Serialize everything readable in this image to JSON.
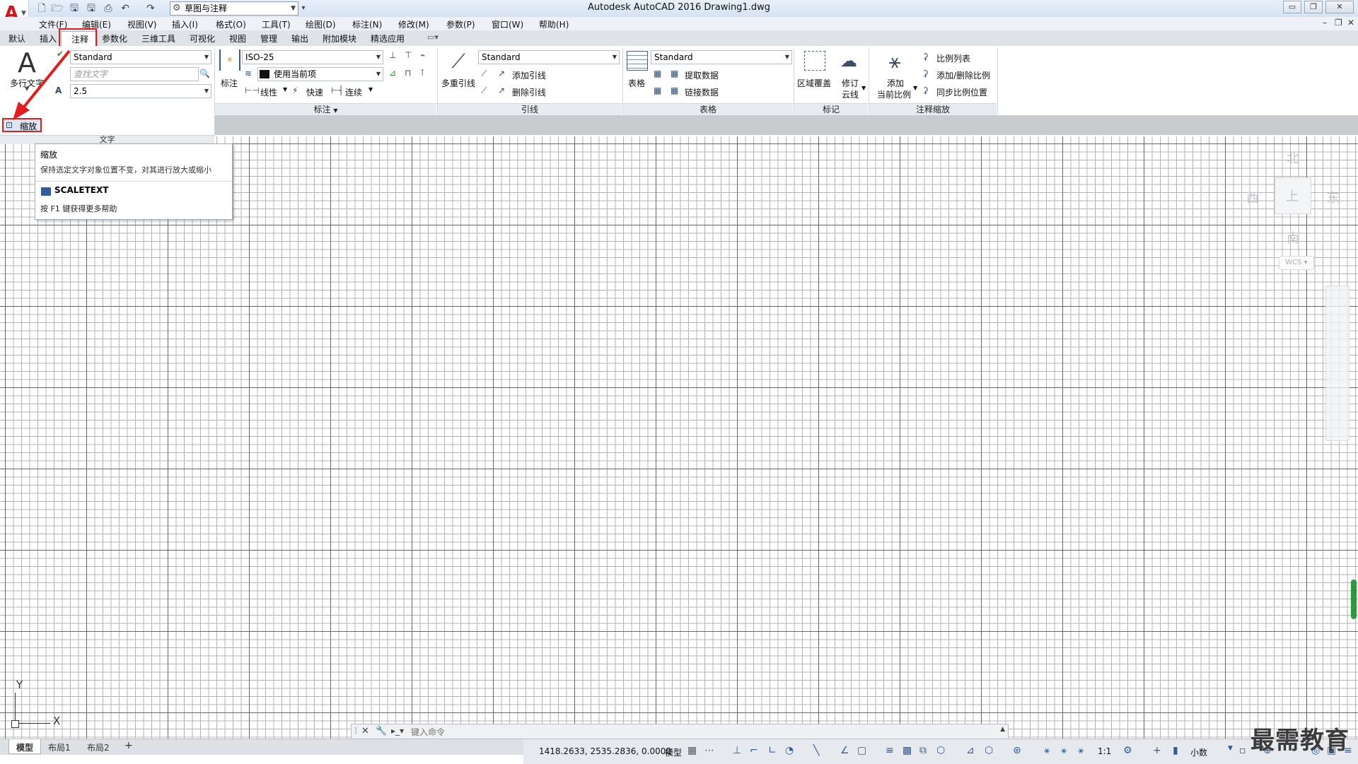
{
  "window": {
    "title": "Autodesk AutoCAD 2016    Drawing1.dwg",
    "workspace": "草图与注释",
    "controls": [
      "▭",
      "❐",
      "✕"
    ],
    "doc_controls": [
      "–",
      "❐",
      "✕"
    ]
  },
  "menu": [
    "文件(F)",
    "编辑(E)",
    "视图(V)",
    "插入(I)",
    "格式(O)",
    "工具(T)",
    "绘图(D)",
    "标注(N)",
    "修改(M)",
    "参数(P)",
    "窗口(W)",
    "帮助(H)"
  ],
  "ribbon_tabs": [
    "默认",
    "插入",
    "注释",
    "参数化",
    "三维工具",
    "可视化",
    "视图",
    "管理",
    "输出",
    "附加模块",
    "精选应用"
  ],
  "active_tab": "注释",
  "ribbon": {
    "text": {
      "mtext_label": "多行文字",
      "style": "Standard",
      "find_placeholder": "查找文字",
      "height": "2.5",
      "panel_title": "文字",
      "scale_button": "缩放"
    },
    "dimension": {
      "label": "标注",
      "style": "ISO-25",
      "layer": "使用当前项",
      "linear": "线性",
      "quick": "快速",
      "continue": "连续",
      "panel_title": "标注"
    },
    "leader": {
      "label": "多重引线",
      "style": "Standard",
      "add": "添加引线",
      "remove": "删除引线",
      "panel_title": "引线"
    },
    "table": {
      "label": "表格",
      "style": "Standard",
      "extract": "提取数据",
      "link": "链接数据",
      "panel_title": "表格"
    },
    "markup": {
      "wipeout": "区域覆盖",
      "revcloud_1": "修订",
      "revcloud_2": "云线",
      "panel_title": "标记"
    },
    "scaling": {
      "add_1": "添加",
      "add_2": "当前比例",
      "scale_list": "比例列表",
      "add_delete": "添加/删除比例",
      "sync": "同步比例位置",
      "panel_title": "注释缩放"
    }
  },
  "tooltip": {
    "title": "缩放",
    "description": "保持选定文字对象位置不变，对其进行放大或缩小",
    "command": "SCALETEXT",
    "help": "按 F1 键获得更多帮助"
  },
  "viewcube": {
    "north": "北",
    "west": "西",
    "east": "东",
    "south": "南",
    "top": "上",
    "wcs": "WCS"
  },
  "ucs": {
    "y": "Y",
    "x": "X"
  },
  "command_line": {
    "placeholder": "键入命令"
  },
  "layout_tabs": [
    "模型",
    "布局1",
    "布局2",
    "+"
  ],
  "status": {
    "coordinates": "1418.2633, 2535.2836, 0.0000",
    "model": "模型",
    "scale": "1:1",
    "units": "小数"
  },
  "watermark": "最需教育"
}
